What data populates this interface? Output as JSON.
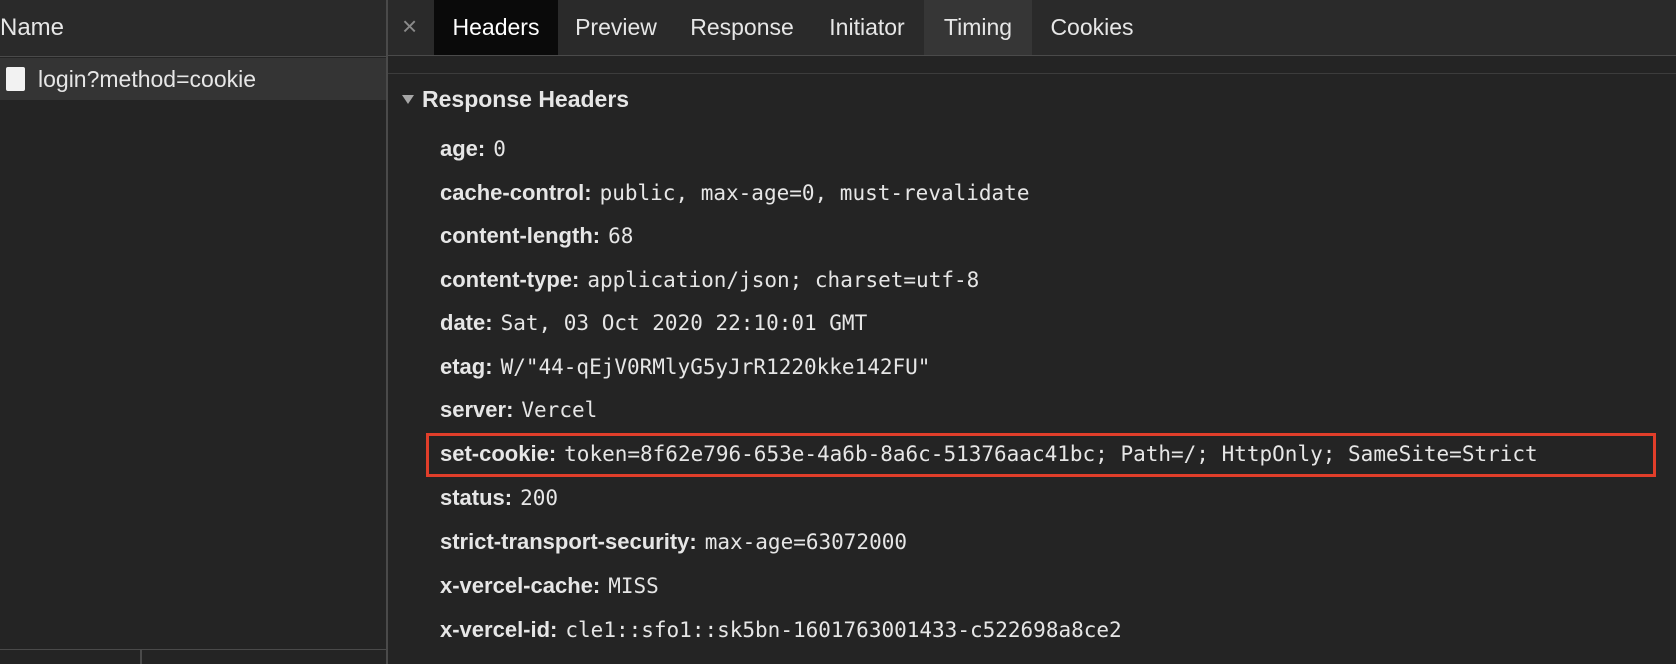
{
  "left_panel": {
    "column_header": "Name",
    "requests": [
      {
        "name": "login?method=cookie",
        "icon": "document-icon"
      }
    ]
  },
  "tabs": {
    "close_glyph": "×",
    "items": [
      {
        "label": "Headers",
        "active": true
      },
      {
        "label": "Preview",
        "active": false
      },
      {
        "label": "Response",
        "active": false
      },
      {
        "label": "Initiator",
        "active": false
      },
      {
        "label": "Timing",
        "active": false
      },
      {
        "label": "Cookies",
        "active": false
      }
    ]
  },
  "response_headers": {
    "title": "Response Headers",
    "rows": [
      {
        "key": "age:",
        "value": "0"
      },
      {
        "key": "cache-control:",
        "value": "public, max-age=0, must-revalidate"
      },
      {
        "key": "content-length:",
        "value": "68"
      },
      {
        "key": "content-type:",
        "value": "application/json; charset=utf-8"
      },
      {
        "key": "date:",
        "value": "Sat, 03 Oct 2020 22:10:01 GMT"
      },
      {
        "key": "etag:",
        "value": "W/\"44-qEjV0RMlyG5yJrR1220kke142FU\""
      },
      {
        "key": "server:",
        "value": "Vercel"
      },
      {
        "key": "set-cookie:",
        "value": "token=8f62e796-653e-4a6b-8a6c-51376aac41bc; Path=/; HttpOnly; SameSite=Strict",
        "highlighted": true
      },
      {
        "key": "status:",
        "value": "200"
      },
      {
        "key": "strict-transport-security:",
        "value": "max-age=63072000"
      },
      {
        "key": "x-vercel-cache:",
        "value": "MISS"
      },
      {
        "key": "x-vercel-id:",
        "value": "cle1::sfo1::sk5bn-1601763001433-c522698a8ce2"
      }
    ]
  },
  "colors": {
    "background": "#242424",
    "active_tab": "#0a0a0a",
    "highlight_border": "#e03e2a"
  }
}
